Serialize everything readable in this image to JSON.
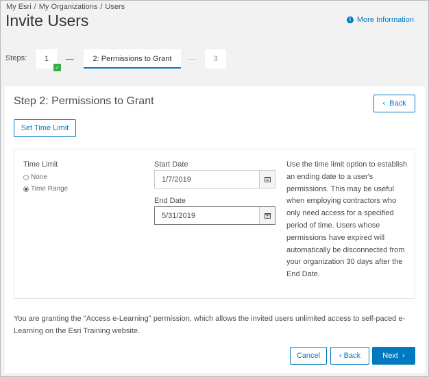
{
  "breadcrumb": {
    "items": [
      "My Esri",
      "My Organizations",
      "Users"
    ],
    "separator": "/"
  },
  "page_title": "Invite Users",
  "more_info": {
    "label": "More Information",
    "icon": "info-icon"
  },
  "steps": {
    "label": "Steps:",
    "items": [
      {
        "label": "1",
        "status": "complete"
      },
      {
        "label": "2:  Permissions to Grant",
        "status": "active"
      },
      {
        "label": "3",
        "status": "pending"
      }
    ]
  },
  "panel": {
    "title": "Step 2: Permissions to Grant",
    "back_label": "Back",
    "set_time_limit_label": "Set Time Limit"
  },
  "time_limit": {
    "label": "Time Limit",
    "options": [
      {
        "label": "None",
        "selected": false
      },
      {
        "label": "Time Range",
        "selected": true
      }
    ]
  },
  "start_date": {
    "label": "Start Date",
    "value": "1/7/2019"
  },
  "end_date": {
    "label": "End Date",
    "value": "5/31/2019"
  },
  "help_text": "Use the time limit option to establish an ending date to a user's permissions. This may be useful when employing contractors who only need access for a specified period of time. Users whose permissions have expired will automatically be disconnected from your organization 30 days after the End Date.",
  "granting_text": "You are granting the \"Access e-Learning\" permission, which allows the invited users unlimited access to self-paced e-Learning on the Esri Training website.",
  "footer": {
    "cancel_label": "Cancel",
    "back_label": "Back",
    "next_label": "Next"
  },
  "colors": {
    "accent": "#0079c1",
    "complete": "#35ac46",
    "background": "#f2f2f2"
  }
}
